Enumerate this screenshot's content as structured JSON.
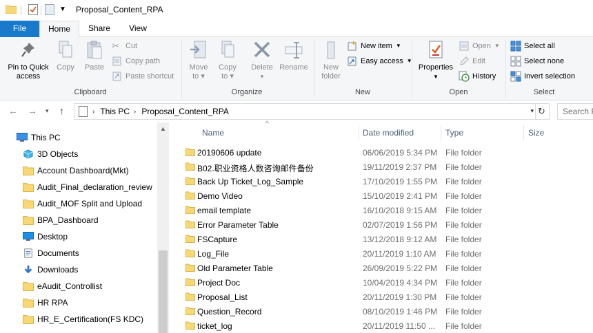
{
  "window": {
    "title": "Proposal_Content_RPA"
  },
  "tabs": [
    "File",
    "Home",
    "Share",
    "View"
  ],
  "ribbon": {
    "clipboard": {
      "label": "Clipboard",
      "pin_label_1": "Pin to Quick",
      "pin_label_2": "access",
      "copy": "Copy",
      "paste": "Paste",
      "cut": "Cut",
      "copy_path": "Copy path",
      "paste_shortcut": "Paste shortcut"
    },
    "organize": {
      "label": "Organize",
      "move_to_1": "Move",
      "move_to_2": "to",
      "copy_to_1": "Copy",
      "copy_to_2": "to",
      "delete": "Delete",
      "rename": "Rename"
    },
    "new": {
      "label": "New",
      "new_folder_1": "New",
      "new_folder_2": "folder",
      "new_item": "New item",
      "easy_access": "Easy access"
    },
    "open": {
      "label": "Open",
      "properties": "Properties",
      "open": "Open",
      "edit": "Edit",
      "history": "History"
    },
    "select": {
      "label": "Select",
      "select_all": "Select all",
      "select_none": "Select none",
      "invert_selection": "Invert selection"
    }
  },
  "address": {
    "crumbs": [
      "This PC",
      "Proposal_Content_RPA"
    ],
    "search_placeholder": "Search P"
  },
  "nav": [
    {
      "label": "This PC",
      "icon": "pc-icon"
    },
    {
      "label": "3D Objects",
      "icon": "cube-icon"
    },
    {
      "label": "Account Dashboard(Mkt)",
      "icon": "folder-icon"
    },
    {
      "label": "Audit_Final_declaration_review",
      "icon": "folder-icon"
    },
    {
      "label": "Audit_MOF Split and Upload",
      "icon": "folder-icon"
    },
    {
      "label": "BPA_Dashboard",
      "icon": "folder-icon"
    },
    {
      "label": "Desktop",
      "icon": "desktop-icon"
    },
    {
      "label": "Documents",
      "icon": "documents-icon"
    },
    {
      "label": "Downloads",
      "icon": "download-icon"
    },
    {
      "label": "eAudit_Controllist",
      "icon": "folder-icon"
    },
    {
      "label": "HR RPA",
      "icon": "folder-icon"
    },
    {
      "label": "HR_E_Certification(FS KDC)",
      "icon": "folder-icon"
    }
  ],
  "columns": {
    "name": "Name",
    "date": "Date modified",
    "type": "Type",
    "size": "Size"
  },
  "files": [
    {
      "name": "20190606 update",
      "date": "06/06/2019 5:34 PM",
      "type": "File folder"
    },
    {
      "name": "B02.职业资格人数咨询邮件备份",
      "date": "19/11/2019 2:37 PM",
      "type": "File folder"
    },
    {
      "name": "Back Up Ticket_Log_Sample",
      "date": "17/10/2019 1:55 PM",
      "type": "File folder"
    },
    {
      "name": "Demo Video",
      "date": "15/10/2019 2:41 PM",
      "type": "File folder"
    },
    {
      "name": "email template",
      "date": "16/10/2018 9:15 AM",
      "type": "File folder"
    },
    {
      "name": "Error Parameter Table",
      "date": "02/07/2019 1:56 PM",
      "type": "File folder"
    },
    {
      "name": "FSCapture",
      "date": "13/12/2018 9:12 AM",
      "type": "File folder"
    },
    {
      "name": "Log_File",
      "date": "20/11/2019 1:10 AM",
      "type": "File folder"
    },
    {
      "name": "Old Parameter Table",
      "date": "26/09/2019 5:22 PM",
      "type": "File folder"
    },
    {
      "name": "Project Doc",
      "date": "10/04/2019 4:34 PM",
      "type": "File folder"
    },
    {
      "name": "Proposal_List",
      "date": "20/11/2019 1:30 PM",
      "type": "File folder"
    },
    {
      "name": "Question_Record",
      "date": "08/10/2019 1:46 PM",
      "type": "File folder"
    },
    {
      "name": "ticket_log",
      "date": "20/11/2019 11:50 ...",
      "type": "File folder"
    }
  ],
  "colors": {
    "accent": "#1979ca",
    "folder": "#f8d775",
    "ribbon_bg": "#f5f6f7"
  }
}
